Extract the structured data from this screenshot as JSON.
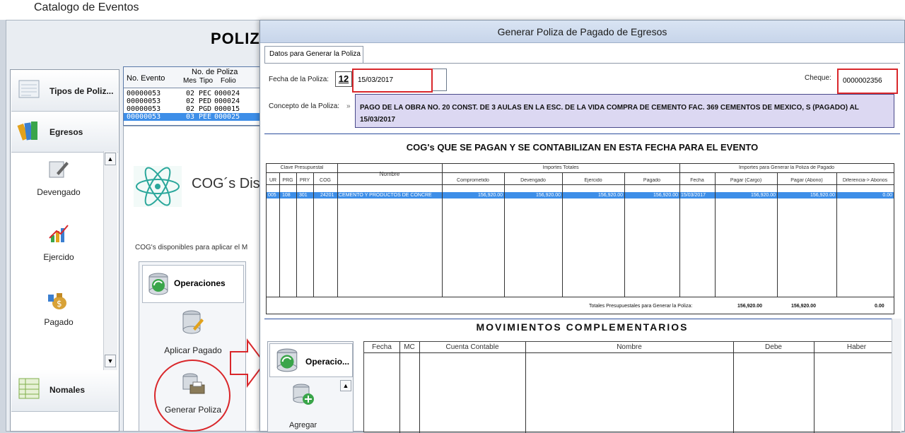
{
  "background": {
    "window_title": "Catalogo de Eventos",
    "poliz_title": "POLIZ",
    "sidebar": {
      "items": [
        {
          "label": "Tipos de Poliz...",
          "icon": "document-list-icon"
        },
        {
          "label": "Egresos",
          "icon": "books-icon"
        },
        {
          "label": "Nomales",
          "icon": "ledger-icon"
        }
      ],
      "sub_items": [
        {
          "label": "Devengado",
          "icon": "pen-paper-icon"
        },
        {
          "label": "Ejercido",
          "icon": "chart-icon"
        },
        {
          "label": "Pagado",
          "icon": "money-bag-icon"
        }
      ],
      "scroll_up": "▲",
      "scroll_down": "▼"
    },
    "event_table": {
      "headers": {
        "evento": "No. Evento",
        "poliza": "No. de Poliza",
        "mes": "Mes",
        "tipo": "Tipo",
        "folio": "Folio"
      },
      "rows": [
        {
          "evento": "00000053",
          "mes": "02",
          "tipo": "PEC",
          "folio": "000024"
        },
        {
          "evento": "00000053",
          "mes": "02",
          "tipo": "PED",
          "folio": "000024"
        },
        {
          "evento": "00000053",
          "mes": "02",
          "tipo": "PGD",
          "folio": "000015"
        },
        {
          "evento": "00000053",
          "mes": "03",
          "tipo": "PEE",
          "folio": "000025",
          "selected": true
        }
      ]
    },
    "cog_panel": {
      "title": "COG´s Dis",
      "subtitle": "COG's disponibles para aplicar el M"
    },
    "operations": {
      "title": "Operaciones",
      "buttons": [
        {
          "label": "Aplicar Pagado",
          "icon": "database-edit-icon"
        },
        {
          "label": "Generar Poliza",
          "icon": "database-printer-icon"
        }
      ]
    }
  },
  "dialog": {
    "title": "Generar Poliza de Pagado de Egresos",
    "tab": "Datos para Generar la Poliza",
    "fecha_label": "Fecha de la Poliza:",
    "fecha_value": "15/03/2017",
    "calendar_glyph": "12",
    "cheque_label": "Cheque:",
    "cheque_value": "0000002356",
    "concepto_label": "Concepto de la Poliza:",
    "concepto_marker": "»",
    "concepto_value": "PAGO DE LA OBRA NO. 20 CONST. DE 3 AULAS EN LA ESC. DE LA VIDA COMPRA DE CEMENTO FAC. 369 CEMENTOS DE MEXICO, S (PAGADO) AL 15/03/2017",
    "cog_section_title": "COG's QUE SE PAGAN Y SE CONTABILIZAN EN ESTA FECHA PARA EL EVENTO",
    "cog_table": {
      "group_clave": "Clave Presupuestal",
      "nombre": "Nombre",
      "group_importes": "Importes Totales",
      "group_generar": "Importes para Generar la Poliza de Pagado",
      "cols": [
        "UR",
        "PRG",
        "PRY",
        "COG",
        "Comprometido",
        "Devengado",
        "Ejercido",
        "Pagado",
        "Fecha",
        "Pagar (Cargo)",
        "Pagar (Abono)",
        "Diferencia-> Abonos"
      ],
      "row": {
        "ur": "005",
        "prg": "108",
        "pry": "301",
        "cog": "24201",
        "nombre": "CEMENTO Y PRODUCTOS DE CONCRE",
        "comprometido": "156,920.00",
        "devengado": "156,920.00",
        "ejercido": "156,920.00",
        "pagado": "156,920.00",
        "fecha": "15/03/2017",
        "cargo": "156,920.00",
        "abono": "156,920.00",
        "diferencia": "0.00"
      },
      "totals_label": "Totales Presupuestales para Generar la Poliza:",
      "total_cargo": "156,920.00",
      "total_abono": "156,920.00",
      "total_diferencia": "0.00"
    },
    "mov_section_title": "MOVIMIENTOS COMPLEMENTARIOS",
    "mov_table": {
      "cols": [
        "Fecha",
        "MC",
        "Cuenta Contable",
        "Nombre",
        "Debe",
        "Haber"
      ]
    },
    "operations": {
      "title": "Operacio...",
      "add_label": "Agregar",
      "scroll_up": "▲"
    }
  },
  "colors": {
    "highlight": "#d9272b",
    "selection": "#3d8ee8",
    "concept_bg": "#dcd8f2"
  }
}
